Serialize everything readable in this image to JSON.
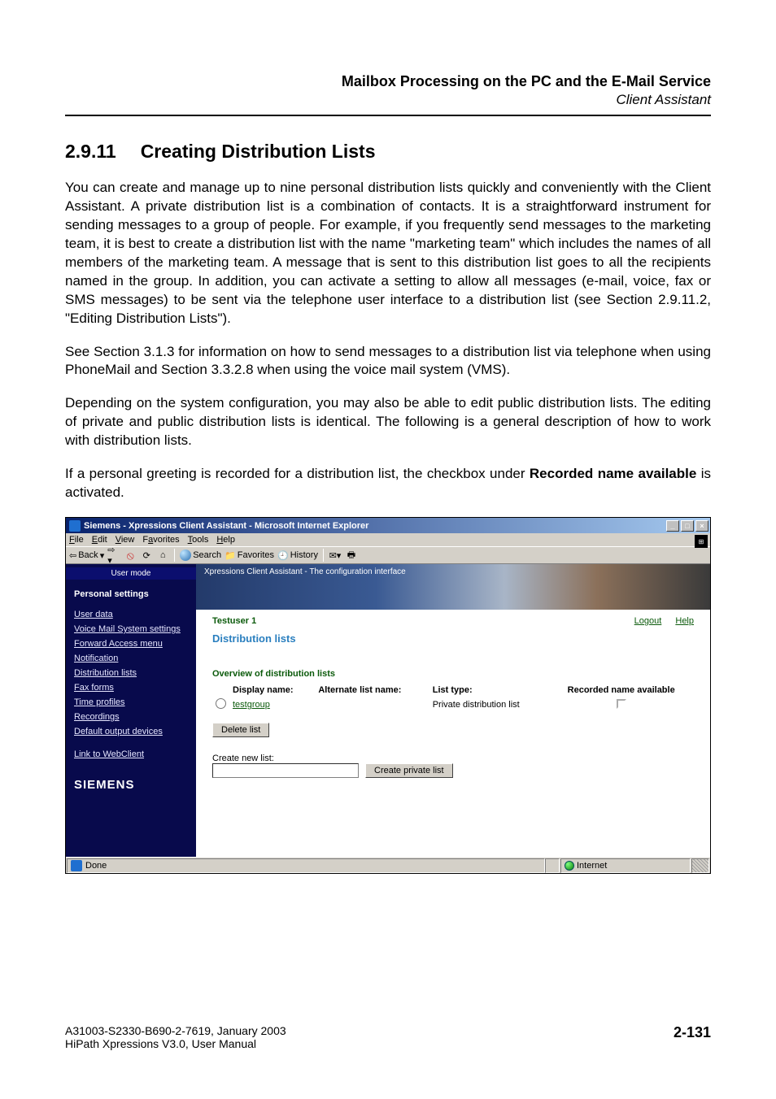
{
  "doc": {
    "header_title": "Mailbox Processing on the PC and the E-Mail Service",
    "header_subtitle": "Client Assistant",
    "section_number": "2.9.11",
    "section_title": "Creating Distribution Lists",
    "p1": "You can create and manage up to nine personal distribution lists quickly and conveniently with the Client Assistant. A private distribution list is a combination of contacts. It is a straightforward instrument for sending messages to a group of people. For example, if you frequently send messages to the marketing team, it is best to create a distribution list with the name \"marketing team\" which includes the names of all members of the marketing team. A message that is sent to this distribution list goes to all the recipients named in the group. In addition, you can activate a setting to allow all messages (e-mail, voice, fax or SMS messages) to be sent via the telephone user interface to a distribution list (see Section 2.9.11.2, \"Editing Distribution Lists\").",
    "p2": "See Section 3.1.3 for information on how to send messages to a distribution list via telephone when using PhoneMail and Section 3.3.2.8 when using the voice mail system (VMS).",
    "p3": "Depending on the system configuration, you may also be able to edit public distribution lists. The editing of private and public distribution lists is identical. The following is a general description of how to work with distribution lists.",
    "p4_prefix": "If a personal greeting is recorded for a distribution list, the checkbox under ",
    "p4_bold": "Recorded name available",
    "p4_suffix": " is activated.",
    "footer_line1": "A31003-S2330-B690-2-7619, January 2003",
    "footer_line2": "HiPath Xpressions V3.0, User Manual",
    "page_number": "2-131"
  },
  "window": {
    "title": "Siemens - Xpressions Client Assistant - Microsoft Internet Explorer",
    "menu": {
      "file": "File",
      "edit": "Edit",
      "view": "View",
      "favorites": "Favorites",
      "tools": "Tools",
      "help": "Help"
    },
    "toolbar": {
      "back": "Back",
      "search": "Search",
      "favorites": "Favorites",
      "history": "History"
    },
    "sidebar": {
      "top": "User mode",
      "heading": "Personal settings",
      "items": [
        "User data",
        "Voice Mail System settings",
        "Forward Access menu",
        "Notification",
        "Distribution lists",
        "Fax forms",
        "Time profiles",
        "Recordings",
        "Default output devices",
        "Link to WebClient"
      ],
      "brand": "SIEMENS"
    },
    "banner": "Xpressions Client Assistant - The configuration interface",
    "main": {
      "user": "Testuser 1",
      "logout": "Logout",
      "help": "Help",
      "block_title": "Distribution lists",
      "overview_title": "Overview of distribution lists",
      "columns": {
        "display_name": "Display name:",
        "alt_name": "Alternate list name:",
        "list_type": "List type:",
        "recorded": "Recorded name available"
      },
      "rows": [
        {
          "name": "testgroup",
          "alt": "",
          "type": "Private distribution list",
          "recorded": false
        }
      ],
      "delete_btn": "Delete list",
      "create_label": "Create new list:",
      "create_btn": "Create private list"
    },
    "status": {
      "left": "Done",
      "right": "Internet"
    }
  }
}
